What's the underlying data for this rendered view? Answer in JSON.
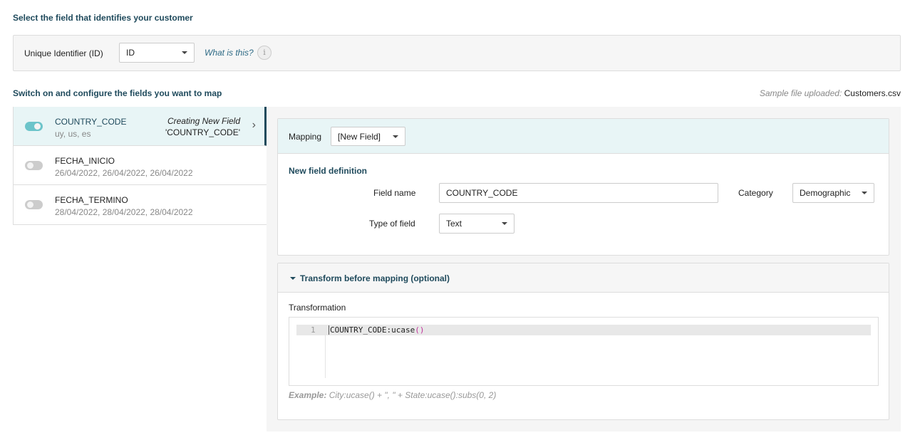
{
  "identifier": {
    "heading": "Select the field that identifies your customer",
    "label": "Unique Identifier (ID)",
    "value": "ID",
    "help_link": "What is this?"
  },
  "fields_section": {
    "heading": "Switch on and configure the fields you want to map",
    "sample_label": "Sample file uploaded:",
    "sample_file": "Customers.csv"
  },
  "fields": [
    {
      "name": "COUNTRY_CODE",
      "sample": "uy, us, es",
      "enabled": true,
      "status_line1": "Creating New Field",
      "status_line2": "'COUNTRY_CODE'"
    },
    {
      "name": "FECHA_INICIO",
      "sample": "26/04/2022, 26/04/2022, 26/04/2022",
      "enabled": false
    },
    {
      "name": "FECHA_TERMINO",
      "sample": "28/04/2022, 28/04/2022, 28/04/2022",
      "enabled": false
    }
  ],
  "mapping": {
    "label": "Mapping",
    "value": "[New Field]",
    "definition_heading": "New field definition",
    "field_name_label": "Field name",
    "field_name_value": "COUNTRY_CODE",
    "category_label": "Category",
    "category_value": "Demographic",
    "type_label": "Type of field",
    "type_value": "Text"
  },
  "transform": {
    "heading": "Transform before mapping (optional)",
    "label": "Transformation",
    "line_number": "1",
    "code_text": "COUNTRY_CODE:ucase",
    "code_parens": "()",
    "example_label": "Example:",
    "example_text": "City:ucase() + \", \" + State:ucase():subs(0, 2)"
  },
  "colors": {
    "accent": "#1f4a5c",
    "toggle_on": "#6cc4ca",
    "selected_bg": "#e8f5f6",
    "paren": "#c0309a"
  }
}
